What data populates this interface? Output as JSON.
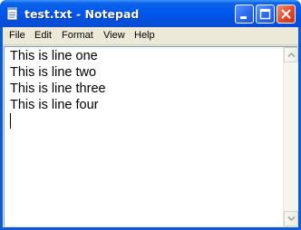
{
  "window": {
    "title": "test.txt - Notepad",
    "app_icon": "notepad-icon",
    "titlebar_color": "#0054e3",
    "close_color": "#e0492a"
  },
  "menubar": {
    "items": [
      {
        "label": "File"
      },
      {
        "label": "Edit"
      },
      {
        "label": "Format"
      },
      {
        "label": "View"
      },
      {
        "label": "Help"
      }
    ]
  },
  "document": {
    "lines": [
      "This is line one",
      "This is line two",
      "This is line three",
      "This is line four",
      ""
    ]
  },
  "icons": {
    "minimize": "minimize-icon",
    "maximize": "maximize-icon",
    "close": "close-icon",
    "scroll_up": "chevron-up-icon",
    "scroll_down": "chevron-down-icon"
  }
}
